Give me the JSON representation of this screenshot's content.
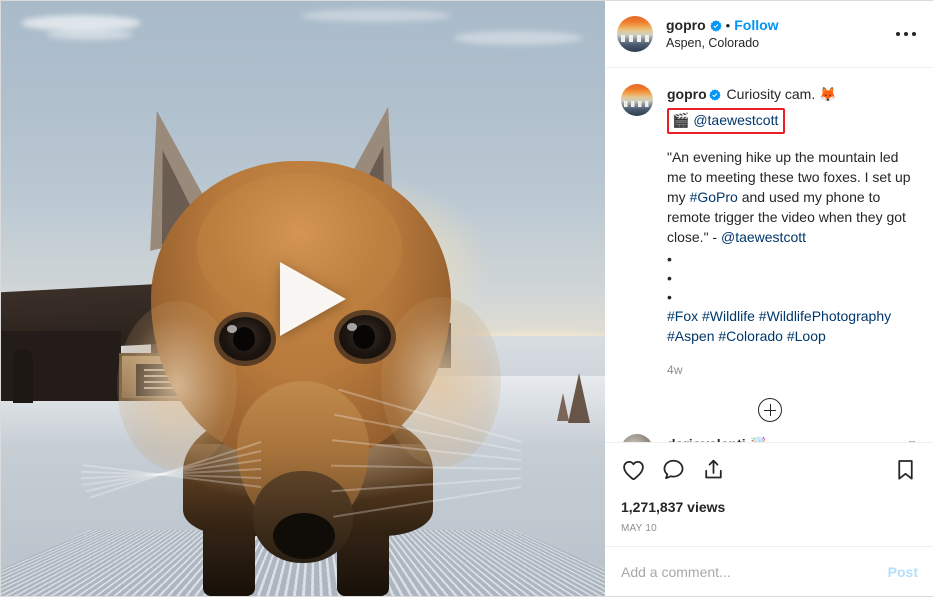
{
  "header": {
    "username": "gopro",
    "verified": true,
    "separator": "•",
    "follow_label": "Follow",
    "location": "Aspen, Colorado",
    "menu_icon": "more-options-icon"
  },
  "caption": {
    "username": "gopro",
    "line1": "Curiosity cam.",
    "fox_emoji": "🦊",
    "clapper_emoji": "🎬",
    "highlighted_mention": "@taewestcott",
    "quote": "\"An evening hike up the mountain led me to meeting these two foxes. I set up my ",
    "quote_tag": "#GoPro",
    "quote_rest": " and used my phone to remote trigger the video when they got close.\" - ",
    "quote_mention": "@taewestcott",
    "spacer_dots": [
      "•",
      "•",
      "•"
    ],
    "hashtags": "#Fox #Wildlife #WildlifePhotography #Aspen #Colorado #Loop",
    "timestamp": "4w"
  },
  "comments": {
    "load_more_icon": "plus-circle-icon",
    "items": [
      {
        "username": "dariovalenti",
        "text": "🤯"
      }
    ]
  },
  "actions": {
    "like_icon": "heart-icon",
    "comment_icon": "comment-bubble-icon",
    "share_icon": "share-arrow-icon",
    "save_icon": "bookmark-icon",
    "views": "1,271,837 views",
    "date": "MAY 10"
  },
  "add_comment": {
    "placeholder": "Add a comment...",
    "post_label": "Post"
  },
  "media": {
    "type": "video",
    "play_icon": "play-triangle-icon",
    "alt": "Close-up of a red fox on groomed snow at sunset"
  },
  "colors": {
    "instagram_blue": "#0095f6",
    "link_navy": "#00376b",
    "highlight_red": "#ee1c25",
    "text_primary": "#262626",
    "text_muted": "#8e8e8e"
  }
}
